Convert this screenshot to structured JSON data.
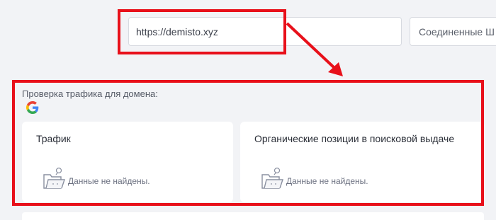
{
  "search": {
    "url_value": "https://demisto.xyz",
    "country_value": "Соединенные Ш"
  },
  "traffic_check": {
    "title": "Проверка трафика для домена:",
    "engine_icon": "google-icon",
    "cards": [
      {
        "title": "Трафик",
        "empty_text": "Данные не найдены.",
        "icon": "empty-folder-icon"
      },
      {
        "title": "Органические позиции в поисковой выдаче",
        "empty_text": "Данные не найдены.",
        "icon": "empty-folder-icon"
      }
    ]
  },
  "colors": {
    "annotation": "#e8101a",
    "background": "#f2f3f6",
    "card": "#ffffff"
  }
}
